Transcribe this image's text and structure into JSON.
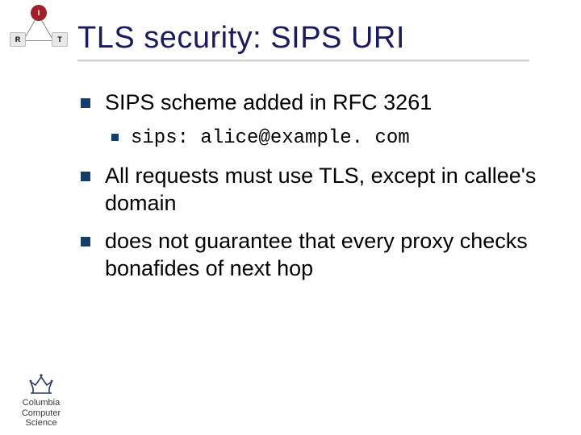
{
  "topleft": {
    "i": "I",
    "r": "R",
    "t": "T"
  },
  "title": "TLS security: SIPS URI",
  "bullets": {
    "b1": "SIPS scheme added in RFC 3261",
    "b1a": "sips: alice@example. com",
    "b2": "All requests must use TLS, except in callee's domain",
    "b3": "does not guarantee that every proxy checks bonafides of next hop"
  },
  "footer": {
    "line1": "Columbia",
    "line2": "Computer",
    "line3": "Science"
  }
}
